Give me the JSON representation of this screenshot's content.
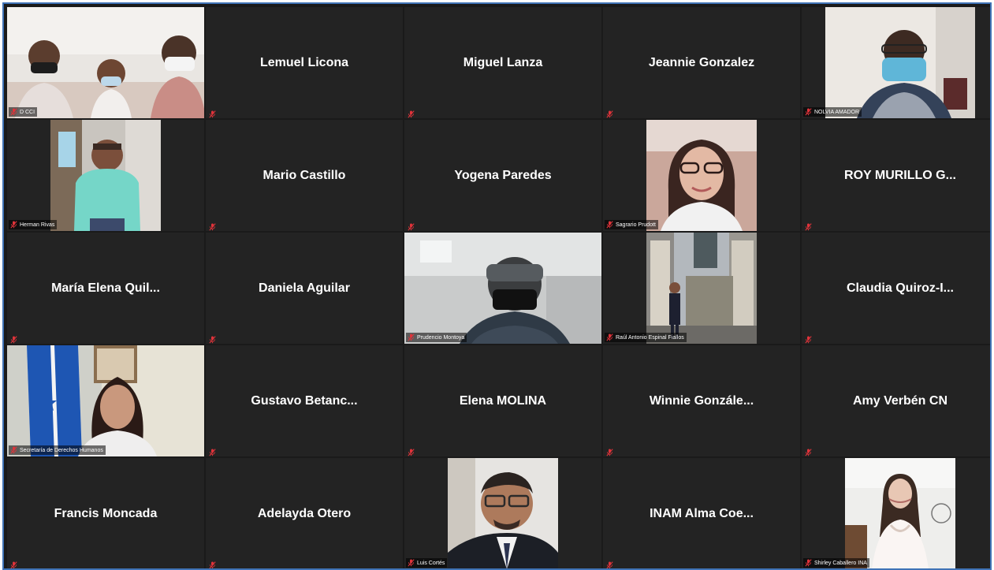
{
  "meeting": {
    "participants": [
      {
        "name": "D CCI",
        "video": true
      },
      {
        "name": "Lemuel Licona",
        "video": false
      },
      {
        "name": "Miguel Lanza",
        "video": false
      },
      {
        "name": "Jeannie Gonzalez",
        "video": false
      },
      {
        "name": "NOLVIA AMADOR",
        "video": true
      },
      {
        "name": "Herman Rivas",
        "video": true
      },
      {
        "name": "Mario Castillo",
        "video": false
      },
      {
        "name": "Yogena Paredes",
        "video": false
      },
      {
        "name": "Sagrario Prudott",
        "video": true
      },
      {
        "name": "ROY MURILLO G...",
        "video": false
      },
      {
        "name": "María Elena Quil...",
        "video": false
      },
      {
        "name": "Daniela Aguilar",
        "video": false
      },
      {
        "name": "Prudencio Montoya",
        "video": true
      },
      {
        "name": "Raúl Antonio Espinal Fiallos",
        "video": true
      },
      {
        "name": "Claudia Quiroz-I...",
        "video": false
      },
      {
        "name": "Secretaría de Derechos Humanos",
        "video": true,
        "active_speaker": true
      },
      {
        "name": "Gustavo Betanc...",
        "video": false
      },
      {
        "name": "Elena MOLINA",
        "video": false
      },
      {
        "name": "Winnie Gonzále...",
        "video": false
      },
      {
        "name": "Amy Verbén CN",
        "video": false
      },
      {
        "name": "Francis Moncada",
        "video": false
      },
      {
        "name": "Adelayda Otero",
        "video": false
      },
      {
        "name": "Luis Cortés",
        "video": true
      },
      {
        "name": "INAM Alma Coe...",
        "video": false
      },
      {
        "name": "Shirley Caballero INA",
        "video": true
      }
    ]
  },
  "icons": {
    "muted": "mic-muted-icon"
  },
  "colors": {
    "window_border": "#3f73b6",
    "tile_bg": "#232323",
    "muted_icon": "#e0333a",
    "active_speaker": "#c8d94a"
  }
}
